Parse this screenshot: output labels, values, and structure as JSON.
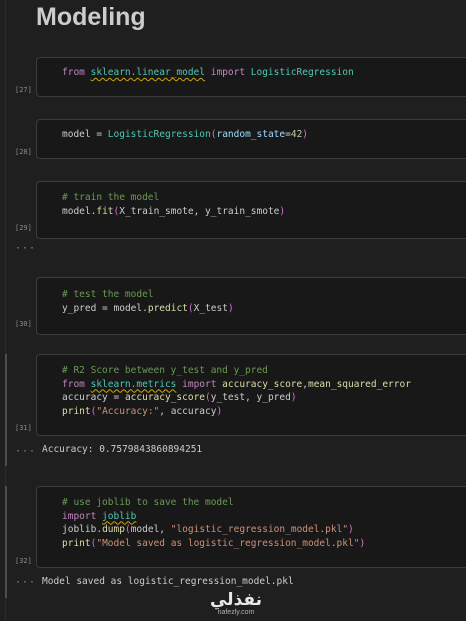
{
  "heading": "Modeling",
  "cells": [
    {
      "count": "[27]",
      "lines": [
        [
          [
            "from ",
            "kw"
          ],
          [
            "sklearn.linear_model",
            "mod squiggle"
          ],
          [
            " import ",
            "kw"
          ],
          [
            "LogisticRegression",
            "cls"
          ]
        ]
      ]
    },
    {
      "count": "[28]",
      "lines": [
        [
          [
            "model ",
            ""
          ],
          [
            "= ",
            ""
          ],
          [
            "LogisticRegression",
            "cls"
          ],
          [
            "(",
            "paren"
          ],
          [
            "random_state",
            "param"
          ],
          [
            "=",
            ""
          ],
          [
            "42",
            "num"
          ],
          [
            ")",
            "paren"
          ]
        ]
      ]
    },
    {
      "count": "[29]",
      "lines": [
        [
          [
            "# train the model",
            "cmt"
          ]
        ],
        [
          [
            "model",
            ""
          ],
          [
            ".",
            ""
          ],
          [
            "fit",
            "fn"
          ],
          [
            "(",
            "paren"
          ],
          [
            "X_train_smote, y_train_smote",
            ""
          ],
          [
            ")",
            "paren"
          ]
        ]
      ]
    },
    {
      "count": "[30]",
      "lines": [
        [
          [
            "# test the model",
            "cmt"
          ]
        ],
        [
          [
            "y_pred ",
            ""
          ],
          [
            "= ",
            ""
          ],
          [
            "model",
            ""
          ],
          [
            ".",
            ""
          ],
          [
            "predict",
            "fn"
          ],
          [
            "(",
            "paren"
          ],
          [
            "X_test",
            ""
          ],
          [
            ")",
            "paren"
          ]
        ]
      ]
    },
    {
      "count": "[31]",
      "lines": [
        [
          [
            "# R2 Score between y_test and y_pred",
            "cmt"
          ]
        ],
        [
          [
            "from ",
            "kw"
          ],
          [
            "sklearn.metrics",
            "mod squiggle"
          ],
          [
            " import ",
            "kw"
          ],
          [
            "accuracy_score",
            "fn"
          ],
          [
            ",",
            ""
          ],
          [
            "mean_squared_error",
            "fn"
          ]
        ],
        [
          [
            "accuracy ",
            ""
          ],
          [
            "= ",
            ""
          ],
          [
            "accuracy_score",
            "fn"
          ],
          [
            "(",
            "paren"
          ],
          [
            "y_test, y_pred",
            ""
          ],
          [
            ")",
            "paren"
          ]
        ],
        [
          [
            "print",
            "fn"
          ],
          [
            "(",
            "paren"
          ],
          [
            "\"Accuracy:\"",
            "str"
          ],
          [
            ", accuracy",
            ""
          ],
          [
            ")",
            "paren"
          ]
        ]
      ],
      "output": "Accuracy: 0.7579843860894251"
    },
    {
      "count": "[32]",
      "lines": [
        [
          [
            "# use joblib to save the model",
            "cmt"
          ]
        ],
        [
          [
            "import ",
            "kw"
          ],
          [
            "joblib",
            "mod squiggle"
          ]
        ],
        [
          [
            "joblib",
            ""
          ],
          [
            ".",
            ""
          ],
          [
            "dump",
            "fn"
          ],
          [
            "(",
            "paren"
          ],
          [
            "model, ",
            ""
          ],
          [
            "\"logistic_regression_model.pkl\"",
            "str"
          ],
          [
            ")",
            "paren"
          ]
        ],
        [
          [
            "print",
            "fn"
          ],
          [
            "(",
            "paren"
          ],
          [
            "\"Model saved as logistic_regression_model.pkl\"",
            "str"
          ],
          [
            ")",
            "paren"
          ]
        ]
      ],
      "output": "Model saved as logistic_regression_model.pkl"
    }
  ],
  "ellipsis": "···",
  "watermark": {
    "main": "نفذلي",
    "sub": "nafezly.com"
  }
}
